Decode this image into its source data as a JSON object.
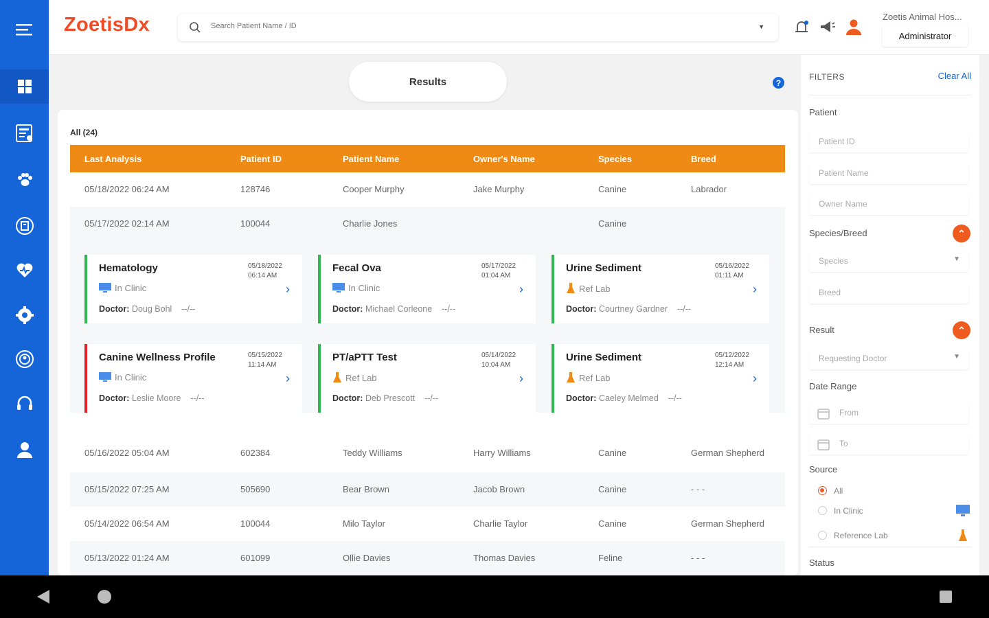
{
  "header": {
    "logo": "ZoetisDx",
    "search_placeholder": "Search Patient Name / ID",
    "hospital": "Zoetis Animal Hos...",
    "role": "Administrator"
  },
  "page": {
    "tab": "Results",
    "count_label": "All (24)"
  },
  "table": {
    "columns": [
      "Last Analysis",
      "Patient ID",
      "Patient Name",
      "Owner's Name",
      "Species",
      "Breed"
    ],
    "rows_top": [
      [
        "05/18/2022 06:24 AM",
        "128746",
        "Cooper Murphy",
        "Jake Murphy",
        "Canine",
        "Labrador"
      ],
      [
        "05/17/2022 02:14 AM",
        "100044",
        "Charlie Jones",
        "",
        "Canine",
        ""
      ]
    ],
    "rows_bottom": [
      [
        "05/16/2022 05:04 AM",
        "602384",
        "Teddy Williams",
        "Harry Williams",
        "Canine",
        "German Shepherd"
      ],
      [
        "05/15/2022 07:25 AM",
        "505690",
        "Bear Brown",
        "Jacob Brown",
        "Canine",
        "- - -"
      ],
      [
        "05/14/2022 06:54 AM",
        "100044",
        "Milo Taylor",
        "Charlie Taylor",
        "Canine",
        "German Shepherd"
      ],
      [
        "05/13/2022 01:24 AM",
        "601099",
        "Ollie Davies",
        "Thomas Davies",
        "Feline",
        "- - -"
      ]
    ]
  },
  "cards": [
    {
      "title": "Hematology",
      "date": "05/18/2022",
      "time": "06:14 AM",
      "source": "In Clinic",
      "doctor_label": "Doctor:",
      "doctor": "Doug Bohl",
      "extra": "--/--"
    },
    {
      "title": "Fecal Ova",
      "date": "05/17/2022",
      "time": "01:04 AM",
      "source": "In Clinic",
      "doctor_label": "Doctor:",
      "doctor": "Michael Corleone",
      "extra": "--/--"
    },
    {
      "title": "Urine Sediment",
      "date": "05/16/2022",
      "time": "01:11 AM",
      "source": "Ref Lab",
      "doctor_label": "Doctor:",
      "doctor": "Courtney Gardner",
      "extra": "--/--"
    },
    {
      "title": "Canine Wellness Profile",
      "date": "05/15/2022",
      "time": "11:14 AM",
      "source": "In Clinic",
      "doctor_label": "Doctor:",
      "doctor": "Leslie Moore",
      "extra": "--/--"
    },
    {
      "title": "PT/aPTT  Test",
      "date": "05/14/2022",
      "time": "10:04 AM",
      "source": "Ref Lab",
      "doctor_label": "Doctor:",
      "doctor": "Deb Prescott",
      "extra": "--/--"
    },
    {
      "title": "Urine Sediment",
      "date": "05/12/2022",
      "time": "12:14 AM",
      "source": "Ref Lab",
      "doctor_label": "Doctor:",
      "doctor": "Caeley Melmed",
      "extra": "--/--"
    }
  ],
  "filters": {
    "title": "FILTERS",
    "clear_all": "Clear All",
    "patient_label": "Patient",
    "patient_id": "Patient ID",
    "patient_name": "Patient Name",
    "owner_name": "Owner Name",
    "species_breed_label": "Species/Breed",
    "species": "Species",
    "breed": "Breed",
    "result_label": "Result",
    "requesting_doctor": "Requesting Doctor",
    "date_range_label": "Date Range",
    "from": "From",
    "to": "To",
    "source_label": "Source",
    "source_all": "All",
    "source_in_clinic": "In Clinic",
    "source_ref_lab": "Reference Lab",
    "status_label": "Status"
  },
  "colors": {
    "sidebar": "#1565d8",
    "accent_orange": "#ef8a14",
    "logo": "#ef4b27",
    "card_green": "#2fb84f",
    "card_red": "#e8202a"
  },
  "icons": {
    "sidebar": [
      "menu-icon",
      "dashboard-icon",
      "report-icon",
      "paw-icon",
      "hospital-icon",
      "heart-icon",
      "settings-icon",
      "support-icon",
      "headset-icon",
      "user-icon"
    ],
    "header": [
      "search-icon",
      "notification-icon",
      "announcement-icon",
      "user-icon"
    ]
  }
}
